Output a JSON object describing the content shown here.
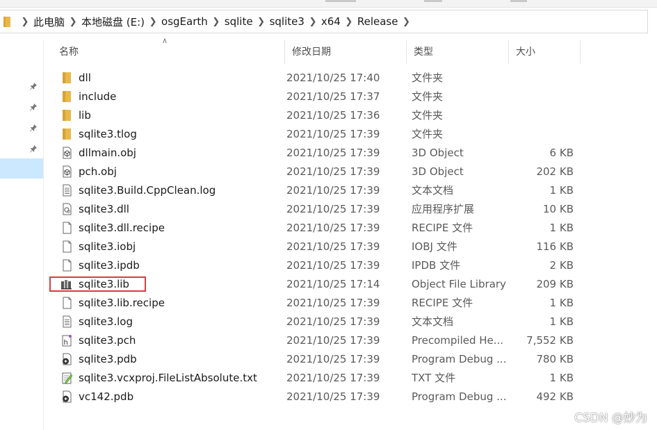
{
  "address": {
    "crumbs": [
      "此电脑",
      "本地磁盘 (E:)",
      "osgEarth",
      "sqlite",
      "sqlite3",
      "x64",
      "Release"
    ]
  },
  "columns": {
    "name": "名称",
    "date": "修改日期",
    "type": "类型",
    "size": "大小"
  },
  "files": [
    {
      "name": "dll",
      "date": "2021/10/25 17:40",
      "type": "文件夹",
      "size": "",
      "icon": "folder-icon"
    },
    {
      "name": "include",
      "date": "2021/10/25 17:37",
      "type": "文件夹",
      "size": "",
      "icon": "folder-icon"
    },
    {
      "name": "lib",
      "date": "2021/10/25 17:36",
      "type": "文件夹",
      "size": "",
      "icon": "folder-icon"
    },
    {
      "name": "sqlite3.tlog",
      "date": "2021/10/25 17:39",
      "type": "文件夹",
      "size": "",
      "icon": "folder-icon"
    },
    {
      "name": "dllmain.obj",
      "date": "2021/10/25 17:39",
      "type": "3D Object",
      "size": "6 KB",
      "icon": "3d-object-icon"
    },
    {
      "name": "pch.obj",
      "date": "2021/10/25 17:39",
      "type": "3D Object",
      "size": "202 KB",
      "icon": "3d-object-icon"
    },
    {
      "name": "sqlite3.Build.CppClean.log",
      "date": "2021/10/25 17:39",
      "type": "文本文档",
      "size": "1 KB",
      "icon": "text-document-icon"
    },
    {
      "name": "sqlite3.dll",
      "date": "2021/10/25 17:39",
      "type": "应用程序扩展",
      "size": "10 KB",
      "icon": "dll-file-icon"
    },
    {
      "name": "sqlite3.dll.recipe",
      "date": "2021/10/25 17:39",
      "type": "RECIPE 文件",
      "size": "1 KB",
      "icon": "blank-file-icon"
    },
    {
      "name": "sqlite3.iobj",
      "date": "2021/10/25 17:39",
      "type": "IOBJ 文件",
      "size": "116 KB",
      "icon": "blank-file-icon"
    },
    {
      "name": "sqlite3.ipdb",
      "date": "2021/10/25 17:39",
      "type": "IPDB 文件",
      "size": "2 KB",
      "icon": "blank-file-icon"
    },
    {
      "name": "sqlite3.lib",
      "date": "2021/10/25 17:14",
      "type": "Object File Library",
      "size": "209 KB",
      "icon": "library-icon"
    },
    {
      "name": "sqlite3.lib.recipe",
      "date": "2021/10/25 17:39",
      "type": "RECIPE 文件",
      "size": "1 KB",
      "icon": "blank-file-icon"
    },
    {
      "name": "sqlite3.log",
      "date": "2021/10/25 17:39",
      "type": "文本文档",
      "size": "1 KB",
      "icon": "text-document-icon"
    },
    {
      "name": "sqlite3.pch",
      "date": "2021/10/25 17:39",
      "type": "Precompiled He...",
      "size": "7,552 KB",
      "icon": "precompiled-header-icon"
    },
    {
      "name": "sqlite3.pdb",
      "date": "2021/10/25 17:39",
      "type": "Program Debug ...",
      "size": "780 KB",
      "icon": "pdb-file-icon"
    },
    {
      "name": "sqlite3.vcxproj.FileListAbsolute.txt",
      "date": "2021/10/25 17:39",
      "type": "TXT 文件",
      "size": "1 KB",
      "icon": "txt-file-icon"
    },
    {
      "name": "vc142.pdb",
      "date": "2021/10/25 17:39",
      "type": "Program Debug ...",
      "size": "492 KB",
      "icon": "pdb-file-icon"
    }
  ],
  "highlight": {
    "file": "sqlite3.lib",
    "color": "#e0393e"
  },
  "selection_color": "#cce8ff",
  "watermark": "CSDN @妙为"
}
